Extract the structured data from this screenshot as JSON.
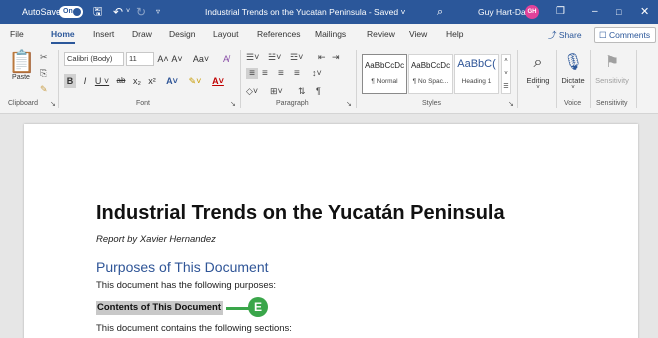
{
  "titlebar": {
    "autosave_label": "AutoSave",
    "autosave_state": "On",
    "doc_title": "Industrial Trends on the Yucatan Peninsula  -  Saved  ˅",
    "user_name": "Guy Hart-Davis",
    "user_initials": "GH",
    "icons": {
      "save": "🖫",
      "undo": "↶",
      "undo_dropdown": "˅",
      "redo": "↻",
      "customize": "▿",
      "search": "⌕",
      "ribbon_display": "❐",
      "minimize": "–",
      "maximize": "□",
      "close": "✕"
    }
  },
  "tabs": [
    "File",
    "Home",
    "Insert",
    "Draw",
    "Design",
    "Layout",
    "References",
    "Mailings",
    "Review",
    "View",
    "Help"
  ],
  "active_tab": "Home",
  "share_label": "⤴ Share",
  "comments_label": "☐ Comments",
  "ribbon": {
    "clipboard": {
      "paste_label": "Paste",
      "paste_icon": "📋",
      "cut_icon": "✂",
      "copy_icon": "⎘",
      "format_painter_icon": "✎",
      "group_label": "Clipboard",
      "launcher": "↘"
    },
    "font": {
      "font_name": "Calibri (Body)",
      "font_size": "11",
      "grow": "A˄",
      "shrink": "A˅",
      "change_case": "Aa˅",
      "clear_format": "A̸",
      "bold": "B",
      "italic": "I",
      "underline": "U ˅",
      "strike": "ab",
      "subscript": "x₂",
      "superscript": "x²",
      "text_effects": "A˅",
      "highlight": "✎˅",
      "font_color": "A˅",
      "group_label": "Font",
      "launcher": "↘"
    },
    "paragraph": {
      "bullets": "☰˅",
      "numbering": "☱˅",
      "multilevel": "☲˅",
      "decrease_indent": "⇤",
      "increase_indent": "⇥",
      "align_left": "≡",
      "center": "≡",
      "align_right": "≡",
      "justify": "≡",
      "line_spacing": "↕˅",
      "shading": "◇˅",
      "borders": "⊞˅",
      "sort": "⇅",
      "show_marks": "¶",
      "group_label": "Paragraph",
      "launcher": "↘"
    },
    "styles": {
      "items": [
        {
          "preview": "AaBbCcDc",
          "name": "¶ Normal"
        },
        {
          "preview": "AaBbCcDc",
          "name": "¶ No Spac..."
        },
        {
          "preview": "AaBbC(",
          "name": "Heading 1"
        }
      ],
      "gallery_arrows": "˄\n˅\n☰",
      "group_label": "Styles",
      "launcher": "↘"
    },
    "editing": {
      "label": "Editing",
      "icon": "⌕",
      "arrow": "˅"
    },
    "voice": {
      "label": "Dictate",
      "icon": "🎙",
      "arrow": "˅",
      "group_label": "Voice"
    },
    "sensitivity": {
      "label": "Sensitivity",
      "icon": "⚑",
      "group_label": "Sensitivity"
    }
  },
  "document": {
    "heading": "Industrial Trends on the Yucatán Peninsula",
    "author_line": "Report by Xavier Hernandez",
    "section_heading": "Purposes of This Document",
    "body_1": "This document has the following purposes:",
    "selected_heading": "Contents of This Document",
    "body_2": "This document contains the following sections:"
  },
  "callout": {
    "label": "E",
    "color": "#3aa64a"
  },
  "colors": {
    "titlebar": "#2b579a",
    "heading2": "#2f5597",
    "selection": "#c8c8c8"
  }
}
